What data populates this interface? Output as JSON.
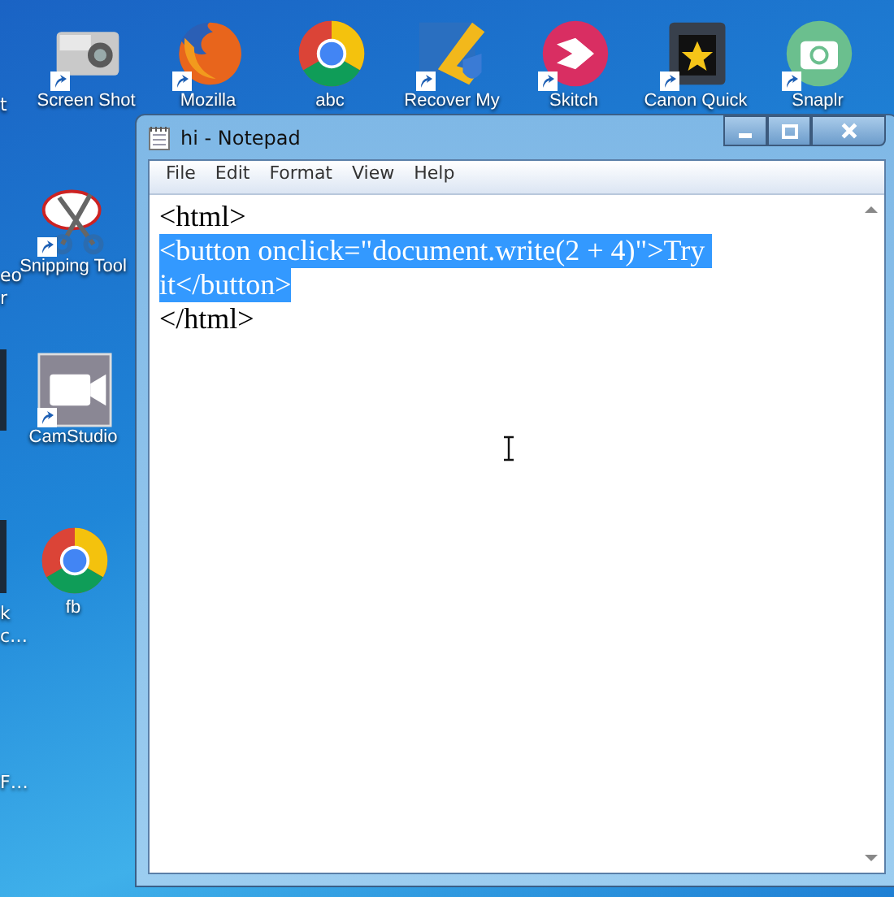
{
  "desktop": {
    "top_row": [
      {
        "label": "Screen Shot",
        "kind": "camera",
        "shortcut": true
      },
      {
        "label": "Mozilla",
        "kind": "firefox",
        "shortcut": true
      },
      {
        "label": "abc",
        "kind": "chrome",
        "shortcut": false
      },
      {
        "label": "Recover My",
        "kind": "boomerang",
        "shortcut": true
      },
      {
        "label": "Skitch",
        "kind": "skitch",
        "shortcut": true
      },
      {
        "label": "Canon Quick",
        "kind": "canon",
        "shortcut": true
      },
      {
        "label": "Snaplr",
        "kind": "snaplr",
        "shortcut": true
      }
    ],
    "side_column": [
      {
        "label": "Snipping Tool",
        "kind": "scissors",
        "shortcut": true
      },
      {
        "label": "CamStudio",
        "kind": "videocam",
        "shortcut": true
      },
      {
        "label": "fb",
        "kind": "chrome",
        "shortcut": false
      }
    ],
    "edge_labels": [
      "t",
      "eo",
      "r",
      "k",
      "c…",
      "F…"
    ]
  },
  "window": {
    "title": "hi - Notepad",
    "menu": [
      "File",
      "Edit",
      "Format",
      "View",
      "Help"
    ],
    "lines": [
      {
        "text": "<html>",
        "selected": false
      },
      {
        "text": "<button onclick=\"document.write(2 + 4)\">Try ",
        "selected": true
      },
      {
        "text": "it</button>",
        "selected": true
      },
      {
        "text": "</html>",
        "selected": false
      }
    ]
  }
}
